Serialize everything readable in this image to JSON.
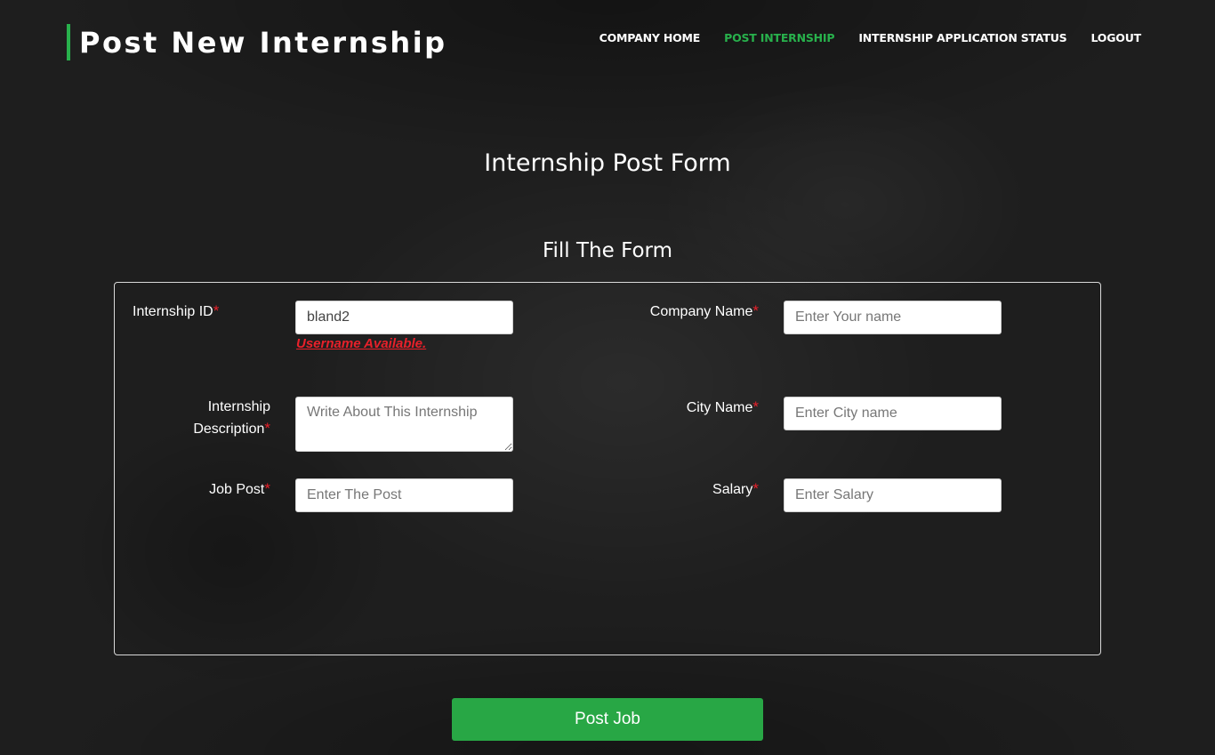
{
  "header": {
    "title": "Post New Internship",
    "nav": [
      {
        "label": "COMPANY HOME",
        "active": false
      },
      {
        "label": "POST INTERNSHIP",
        "active": true
      },
      {
        "label": "INTERNSHIP APPLICATION STATUS",
        "active": false
      },
      {
        "label": "LOGOUT",
        "active": false
      }
    ]
  },
  "form": {
    "heading": "Internship Post Form",
    "subheading": "Fill The Form",
    "required_marker": "*",
    "fields": {
      "internship_id": {
        "label": "Internship ID",
        "value": "bland2",
        "placeholder": ""
      },
      "internship_id_status": "Username Available.",
      "description": {
        "label_line1": "Internship",
        "label_line2": "Description",
        "value": "",
        "placeholder": "Write About This Internship"
      },
      "job_post": {
        "label": "Job Post",
        "value": "",
        "placeholder": "Enter The Post"
      },
      "company_name": {
        "label": "Company Name",
        "value": "",
        "placeholder": "Enter Your name"
      },
      "city_name": {
        "label": "City Name",
        "value": "",
        "placeholder": "Enter City name"
      },
      "salary": {
        "label": "Salary",
        "value": "",
        "placeholder": "Enter Salary"
      }
    },
    "submit_label": "Post Job"
  },
  "colors": {
    "accent": "#28b14c",
    "required": "#e8202a",
    "button": "#28a745",
    "background": "#1e1e1e"
  }
}
